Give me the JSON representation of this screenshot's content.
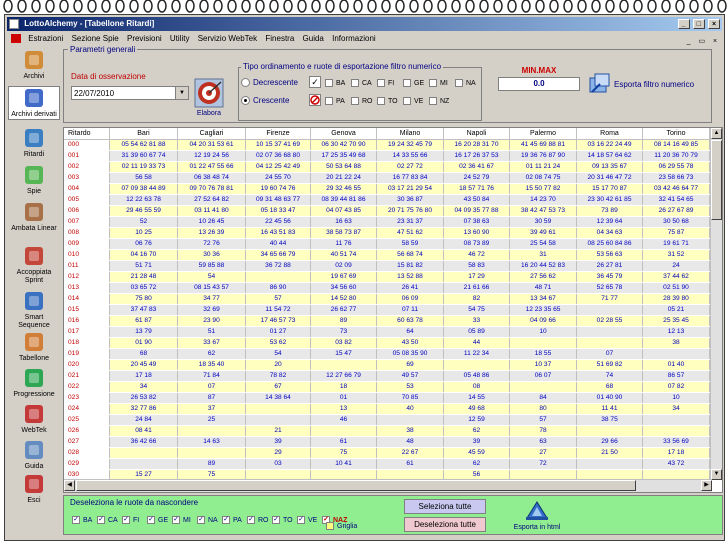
{
  "window": {
    "title": "LottoAlchemy - [Tabellone Ritardi]"
  },
  "menu": [
    "Estrazioni",
    "Sezione Spie",
    "Previsioni",
    "Utility",
    "Servizio WebTek",
    "Finestra",
    "Guida",
    "Informazioni"
  ],
  "sidebar": [
    {
      "label": "Archivi",
      "icon": "pencil-icon"
    },
    {
      "label": "Archivi derivati",
      "icon": "document-icon"
    },
    {
      "label": "Ritardi",
      "icon": "clock-icon"
    },
    {
      "label": "Spie",
      "icon": "spyglass-icon"
    },
    {
      "label": "Ambata Linear",
      "icon": "letter-a-icon"
    },
    {
      "label": "Accoppiata Sprint",
      "icon": "arrows-icon"
    },
    {
      "label": "Smart Sequence",
      "icon": "shield-icon"
    },
    {
      "label": "Tabellone",
      "icon": "calendar-icon"
    },
    {
      "label": "Progressione",
      "icon": "dollar-icon"
    },
    {
      "label": "WebTek",
      "icon": "webtek-a-icon"
    },
    {
      "label": "Guida",
      "icon": "book-icon"
    },
    {
      "label": "Esci",
      "icon": "power-icon"
    }
  ],
  "params": {
    "legend": "Parametri generali",
    "date_label": "Data di osservazione",
    "date_value": "22/07/2010",
    "elabora_label": "Elabora"
  },
  "sort": {
    "legend": "Tipo ordinamento e ruote di esportazione filtro numerico",
    "options": [
      "Decrescente",
      "Crescente"
    ],
    "selected": "Crescente",
    "wheels_row1": [
      "BA",
      "CA",
      "FI",
      "GE",
      "MI",
      "NA"
    ],
    "wheels_row2": [
      "PA",
      "RO",
      "TO",
      "VE",
      "NZ"
    ]
  },
  "minmax": {
    "label": "MIN.MAX",
    "value": "0.0"
  },
  "export_filter_label": "Esporta filtro numerico",
  "grid": {
    "headers": [
      "Ritardo",
      "Bari",
      "Cagliari",
      "Firenze",
      "Genova",
      "Milano",
      "Napoli",
      "Palermo",
      "Roma",
      "Torino"
    ],
    "rows": [
      [
        "000",
        "05 54 62 81 88",
        "04 20 31 53 61",
        "10 15 37 41 69",
        "06 30 42 70 90",
        "19 24 32 45 79",
        "16 20 28 31 70",
        "41 45 69 88 81",
        "03 16 22 24 49",
        "08 14 16 49 85"
      ],
      [
        "001",
        "31 39 60 67 74",
        "12 19 24 56",
        "02 07 36 68 80",
        "17 25 35 49 68",
        "14 33 55 66",
        "16 17 26 37 53",
        "19 36 76 87 90",
        "14 18 57 64 62",
        "11 20 36 70 79"
      ],
      [
        "002",
        "02 11 19 33 73",
        "01 22 47 55 66",
        "04 12 25 42 49",
        "50 53 64 88",
        "02 27 72",
        "02 36 41 67",
        "01 11 21 24",
        "09 13 35 67",
        "06 29 55 78"
      ],
      [
        "003",
        "56 58",
        "06 38 48 74",
        "24 55 70",
        "20 21 22 24",
        "16 77 83 84",
        "24 52 79",
        "02 08 74 75",
        "20 31 46 47 72",
        "23 58 66 73"
      ],
      [
        "004",
        "07 09 38 44 89",
        "09 70 76 78 81",
        "19 60 74 76",
        "29 32 46 55",
        "03 17 21 29 54",
        "18 57 71 76",
        "15 50 77 82",
        "15 17 70 87",
        "03 42 46 64 77"
      ],
      [
        "005",
        "12 22 63 78",
        "27 52 64 82",
        "09 31 48 63 77",
        "08 39 44 81 86",
        "30 36 87",
        "43 50 84",
        "14 23 70",
        "23 30 42 61 85",
        "32 41 54 65"
      ],
      [
        "006",
        "29 46 55 59",
        "03 11 41 80",
        "05 18 33 47",
        "04 07 43 85",
        "20 71 75 76 80",
        "04 09 35 77 88",
        "38 42 47 53 73",
        "73 89",
        "26 27 67 89"
      ],
      [
        "007",
        "52",
        "10 26 45",
        "22 45 56",
        "16 63",
        "23 31 37",
        "07 38 63",
        "30 59",
        "12 39 64",
        "30 50 68"
      ],
      [
        "008",
        "10 25",
        "13 26 39",
        "16 43 51 83",
        "38 58 73 87",
        "47 51 62",
        "13 60 90",
        "39 49 61",
        "04 34 63",
        "75 87"
      ],
      [
        "009",
        "06 76",
        "72 76",
        "40 44",
        "11 76",
        "58 59",
        "08 73 89",
        "25 54 58",
        "08 25 60 84 86",
        "19 61 71"
      ],
      [
        "010",
        "04 16 70",
        "30 36",
        "34 65 66 79",
        "40 51 74",
        "56 68 74",
        "46 72",
        "31",
        "53 56 63",
        "31 52"
      ],
      [
        "011",
        "51 71",
        "59 85 88",
        "36 72 88",
        "02 09",
        "15 81 82",
        "58 83",
        "16 20 44 52 83",
        "26 27 81",
        "24"
      ],
      [
        "012",
        "21 28 48",
        "54",
        "",
        "19 67 69",
        "13 52 88",
        "17 29",
        "27 56 62",
        "36 45 79",
        "37 44 62"
      ],
      [
        "013",
        "03 65 72",
        "08 15 43 57",
        "86 90",
        "34 56 60",
        "26 41",
        "21 61 66",
        "48 71",
        "52 65 78",
        "02 51 90"
      ],
      [
        "014",
        "75 80",
        "34 77",
        "57",
        "14 52 80",
        "06 09",
        "82",
        "13 34 67",
        "71 77",
        "28 39 80"
      ],
      [
        "015",
        "37 47 83",
        "32 69",
        "11 54 72",
        "26 62 77",
        "07 11",
        "54 75",
        "12 23 35 65",
        "",
        "05 21"
      ],
      [
        "016",
        "61 87",
        "23 90",
        "17 46 57 73",
        "89",
        "60 63 78",
        "33",
        "04 09 66",
        "02 28 55",
        "25 35 45"
      ],
      [
        "017",
        "13 79",
        "51",
        "01 27",
        "73",
        "64",
        "05 89",
        "10",
        "",
        "12 13"
      ],
      [
        "018",
        "01 90",
        "33 67",
        "53 62",
        "03 82",
        "43 50",
        "44",
        "",
        "",
        "38"
      ],
      [
        "019",
        "68",
        "62",
        "54",
        "15 47",
        "05 08 35 90",
        "11 22 34",
        "18 55",
        "07",
        ""
      ],
      [
        "020",
        "20 45 49",
        "18 35 40",
        "20",
        "",
        "69",
        "",
        "10 37",
        "51 69 82",
        "01 40"
      ],
      [
        "021",
        "17 18",
        "71 84",
        "78 82",
        "12 27 66 79",
        "49 57",
        "05 48 86",
        "06 07",
        "74",
        "86 57"
      ],
      [
        "022",
        "34",
        "07",
        "67",
        "18",
        "53",
        "08",
        "",
        "68",
        "07 82"
      ],
      [
        "023",
        "26 53 82",
        "87",
        "14 38 64",
        "01",
        "70 85",
        "14 55",
        "84",
        "01 40 90",
        "10"
      ],
      [
        "024",
        "32 77 86",
        "37",
        "",
        "13",
        "40",
        "49 68",
        "80",
        "11 41",
        "34"
      ],
      [
        "025",
        "24 84",
        "25",
        "",
        "46",
        "",
        "12 59",
        "57",
        "38 75",
        ""
      ],
      [
        "026",
        "08 41",
        "",
        "21",
        "",
        "38",
        "62",
        "78",
        "",
        ""
      ],
      [
        "027",
        "36 42 66",
        "14 63",
        "39",
        "61",
        "48",
        "39",
        "63",
        "29 66",
        "33 56 69"
      ],
      [
        "028",
        "",
        "",
        "29",
        "75",
        "22 67",
        "45 59",
        "27",
        "21 50",
        "17 18"
      ],
      [
        "029",
        "",
        "89",
        "03",
        "10 41",
        "61",
        "62",
        "72",
        "",
        "43 72"
      ],
      [
        "030",
        "15 27",
        "75",
        "",
        "",
        "",
        "56",
        "",
        "",
        ""
      ]
    ]
  },
  "bottom": {
    "legend": "Deseleziona le ruote da nascondere",
    "wheels": [
      "BA",
      "CA",
      "FI",
      "GE",
      "MI",
      "NA",
      "PA",
      "RO",
      "TO",
      "VE",
      "NAZ"
    ],
    "select_all": "Seleziona tutte",
    "deselect_all": "Deseleziona tutte",
    "grid_label": "Griglia",
    "export_html": "Esporta in html"
  }
}
